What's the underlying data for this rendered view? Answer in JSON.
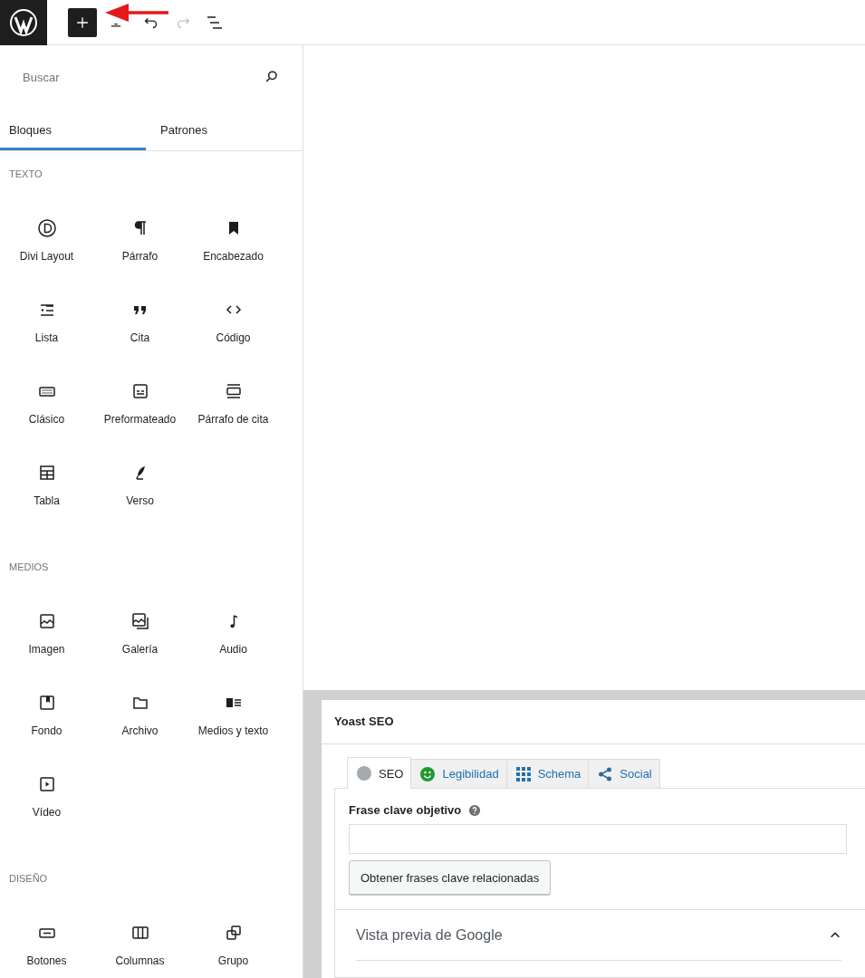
{
  "toolbar": {
    "inserter_pressed": true,
    "redo_disabled": true
  },
  "inserter": {
    "search": {
      "placeholder": "Buscar"
    },
    "tabs": [
      {
        "label": "Bloques",
        "selected": true
      },
      {
        "label": "Patrones",
        "selected": false
      }
    ],
    "sections": [
      {
        "heading": "TEXTO",
        "blocks": [
          {
            "label": "Divi Layout"
          },
          {
            "label": "Párrafo"
          },
          {
            "label": "Encabezado"
          },
          {
            "label": "Lista"
          },
          {
            "label": "Cita"
          },
          {
            "label": "Código"
          },
          {
            "label": "Clásico"
          },
          {
            "label": "Preformateado"
          },
          {
            "label": "Párrafo de cita"
          },
          {
            "label": "Tabla"
          },
          {
            "label": "Verso"
          }
        ]
      },
      {
        "heading": "MEDIOS",
        "blocks": [
          {
            "label": "Imagen"
          },
          {
            "label": "Galería"
          },
          {
            "label": "Audio"
          },
          {
            "label": "Fondo"
          },
          {
            "label": "Archivo"
          },
          {
            "label": "Medios y texto"
          },
          {
            "label": "Vídeo"
          }
        ]
      },
      {
        "heading": "DISEÑO",
        "blocks": [
          {
            "label": "Botones"
          },
          {
            "label": "Columnas"
          },
          {
            "label": "Grupo"
          }
        ]
      }
    ]
  },
  "yoast": {
    "title": "Yoast SEO",
    "tabs": [
      {
        "label": "SEO",
        "selected": true,
        "kind": "score",
        "color": "#a7aaad"
      },
      {
        "label": "Legibilidad",
        "selected": false,
        "kind": "smiley",
        "color": "#1e9a2f"
      },
      {
        "label": "Schema",
        "selected": false,
        "kind": "grid"
      },
      {
        "label": "Social",
        "selected": false,
        "kind": "share"
      }
    ],
    "keyphrase": {
      "label": "Frase clave objetivo"
    },
    "related_button": "Obtener frases clave relacionadas",
    "google_preview": {
      "title": "Vista previa de Google",
      "expanded": true
    }
  }
}
